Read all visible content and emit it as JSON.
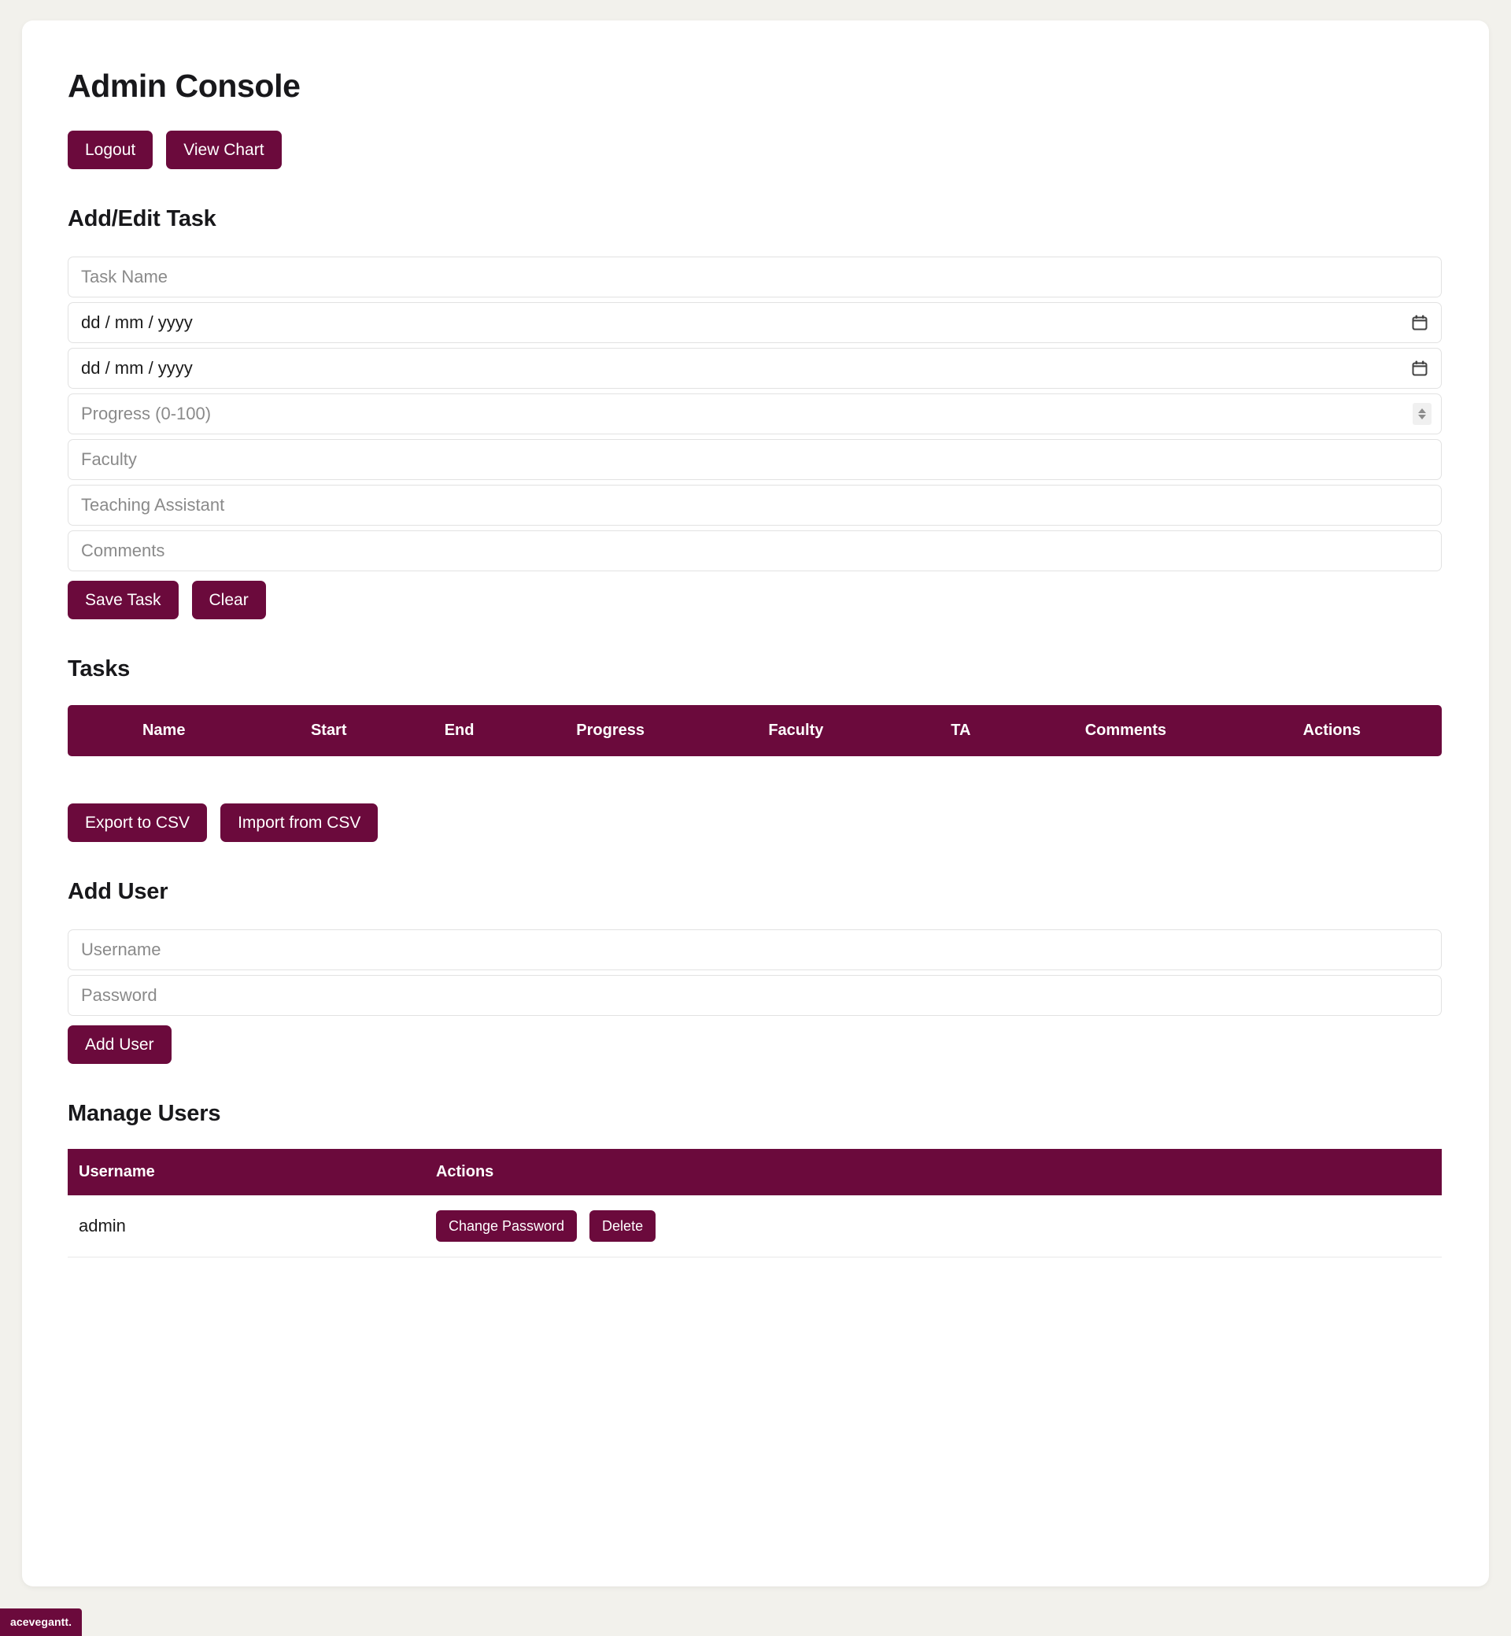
{
  "page": {
    "title": "Admin Console",
    "background_color": "#f2f1ec",
    "accent_color": "#6b0a3c",
    "card_color": "#ffffff"
  },
  "top_actions": {
    "logout_label": "Logout",
    "view_chart_label": "View Chart"
  },
  "task_form": {
    "heading": "Add/Edit Task",
    "fields": [
      {
        "name": "task-name",
        "placeholder": "Task Name",
        "value": "",
        "type": "text"
      },
      {
        "name": "start-date",
        "placeholder": "dd / mm / yyyy",
        "value": "",
        "type": "date"
      },
      {
        "name": "end-date",
        "placeholder": "dd / mm / yyyy",
        "value": "",
        "type": "date"
      },
      {
        "name": "progress",
        "placeholder": "Progress (0-100)",
        "value": "",
        "type": "number"
      },
      {
        "name": "faculty",
        "placeholder": "Faculty",
        "value": "",
        "type": "text"
      },
      {
        "name": "teaching-assistant",
        "placeholder": "Teaching Assistant",
        "value": "",
        "type": "text"
      },
      {
        "name": "comments",
        "placeholder": "Comments",
        "value": "",
        "type": "text"
      }
    ],
    "date_placeholder": "dd / mm / yyyy",
    "save_label": "Save Task",
    "clear_label": "Clear",
    "calendar_icon": "calendar-icon",
    "spinner_icon": "number-stepper-icon"
  },
  "tasks_section": {
    "heading": "Tasks",
    "columns": [
      "Name",
      "Start",
      "End",
      "Progress",
      "Faculty",
      "TA",
      "Comments",
      "Actions"
    ],
    "rows": [],
    "export_label": "Export to CSV",
    "import_label": "Import from CSV"
  },
  "add_user": {
    "heading": "Add User",
    "username_placeholder": "Username",
    "username_value": "",
    "password_placeholder": "Password",
    "password_value": "",
    "submit_label": "Add User"
  },
  "manage_users": {
    "heading": "Manage Users",
    "columns": [
      "Username",
      "Actions"
    ],
    "rows": [
      {
        "username": "admin",
        "change_password_label": "Change Password",
        "delete_label": "Delete"
      }
    ]
  },
  "brand": {
    "badge_label": "acevegantt."
  }
}
